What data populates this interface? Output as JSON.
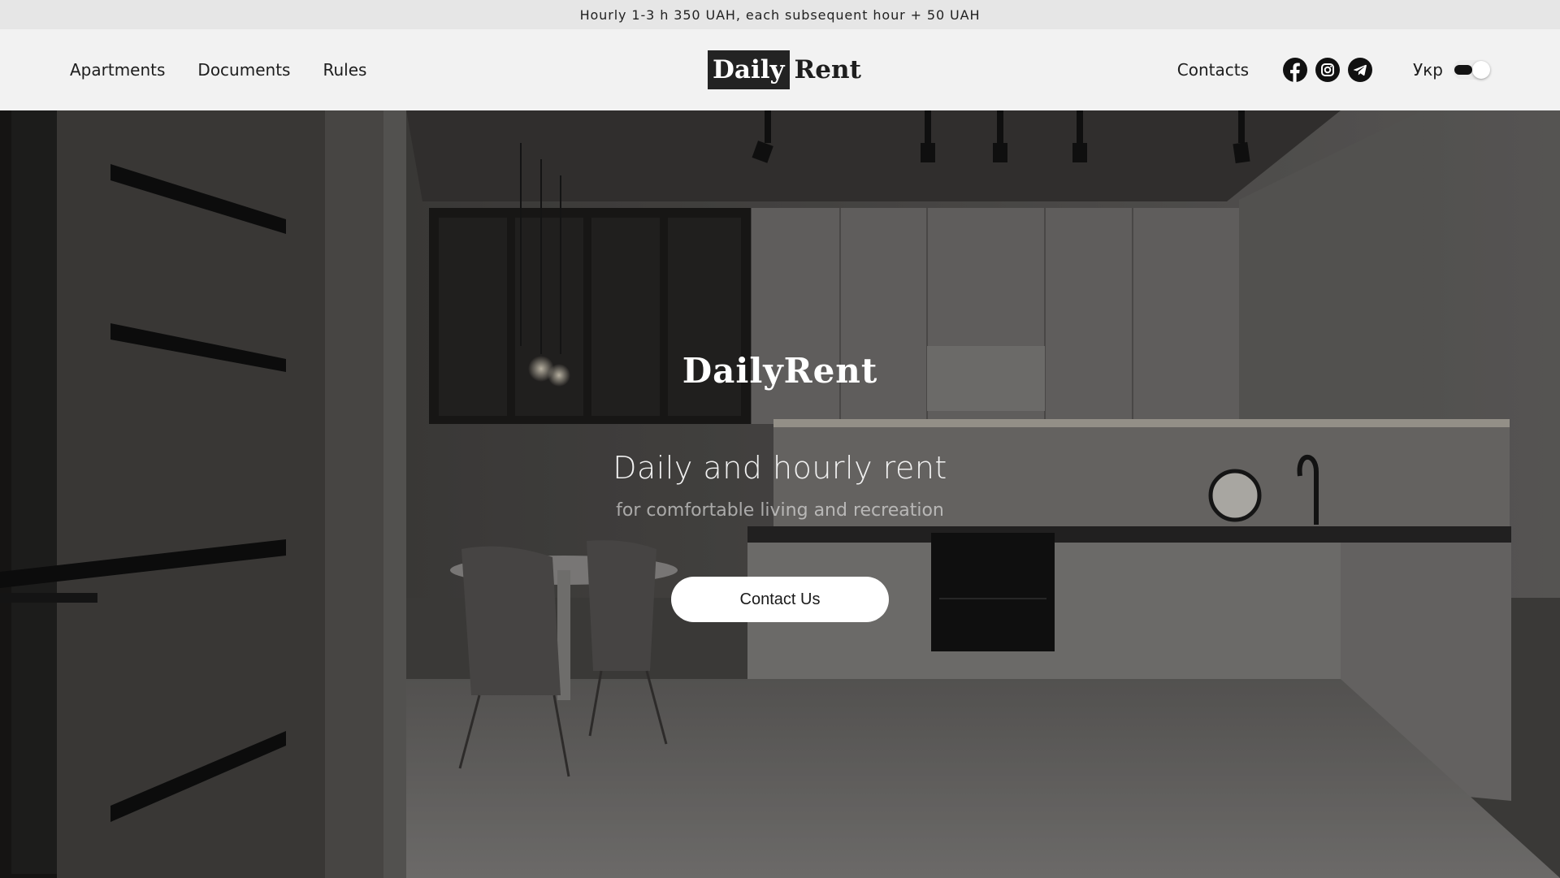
{
  "announcement": "Hourly 1-3 h 350 UAH, each subsequent hour + 50 UAH",
  "header": {
    "nav_left": [
      "Apartments",
      "Documents",
      "Rules"
    ],
    "logo": {
      "part1": "Daily",
      "part2": "Rent"
    },
    "contacts": "Contacts",
    "socials": [
      "facebook-icon",
      "instagram-icon",
      "telegram-icon"
    ],
    "language": "Укр"
  },
  "hero": {
    "brand": "DailyRent",
    "title": "Daily and hourly rent",
    "subtitle": "for comfortable living and recreation",
    "cta": "Contact Us"
  },
  "colors": {
    "announce_bg": "#e6e6e6",
    "header_bg": "#f2f2f2",
    "logo_dark": "#232323",
    "cta_bg": "#ffffff"
  }
}
